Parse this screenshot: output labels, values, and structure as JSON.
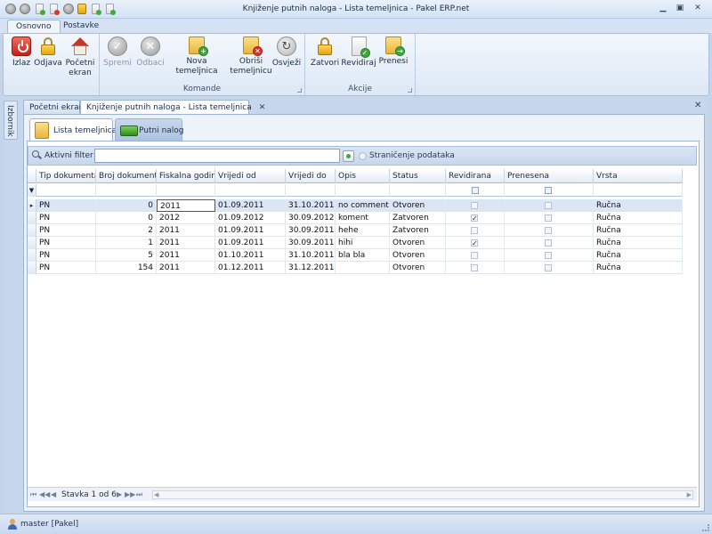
{
  "window": {
    "title": "Knjiženje putnih naloga - Lista temeljnica - Pakel ERP.net"
  },
  "ribbon_tabs": [
    {
      "label": "Osnovno",
      "active": true
    },
    {
      "label": "Postavke",
      "active": false
    }
  ],
  "ribbon": {
    "groups": [
      {
        "label": "",
        "buttons": [
          {
            "label": "Izlaz",
            "icon": "power-icon"
          },
          {
            "label": "Odjava",
            "icon": "lock-icon"
          },
          {
            "label": "Početni\nekran",
            "icon": "home-icon"
          }
        ]
      },
      {
        "label": "Komande",
        "buttons": [
          {
            "label": "Spremi",
            "icon": "check-icon",
            "disabled": true
          },
          {
            "label": "Odbaci",
            "icon": "cancel-icon",
            "disabled": true
          },
          {
            "label": "Nova temeljnica",
            "icon": "new-folder-icon"
          },
          {
            "label": "Obriši\ntemeljnicu",
            "icon": "delete-folder-icon"
          },
          {
            "label": "Osvježi",
            "icon": "refresh-icon"
          }
        ]
      },
      {
        "label": "Akcije",
        "buttons": [
          {
            "label": "Zatvori",
            "icon": "lock-icon"
          },
          {
            "label": "Revidiraj",
            "icon": "revise-icon"
          },
          {
            "label": "Prenesi",
            "icon": "transfer-icon"
          }
        ]
      }
    ]
  },
  "sidebar": {
    "label": "Izbornik"
  },
  "doc_tabs": [
    {
      "label": "Početni ekran",
      "active": false
    },
    {
      "label": "Knjiženje putnih naloga - Lista temeljnica",
      "active": true,
      "close": "✕"
    }
  ],
  "workspace_close": "✕",
  "inner_tabs": [
    {
      "label": "Lista temeljnica",
      "active": true,
      "icon": "folder-icon"
    },
    {
      "label": "Putni nalog",
      "active": false,
      "icon": "truck-icon"
    }
  ],
  "filter": {
    "label": "Aktivni filter",
    "value": "",
    "paging_label": "Straničenje podataka",
    "paging_checked": false
  },
  "grid": {
    "columns": [
      "Tip dokumenta",
      "Broj dokumenta",
      "Fiskalna godina",
      "Vrijedi od",
      "Vrijedi do",
      "Opis",
      "Status",
      "Revidirana",
      "Prenesena",
      "Vrsta"
    ],
    "rows": [
      {
        "tip": "PN",
        "broj": "0",
        "godina": "2011",
        "od": "01.09.2011",
        "do": "31.10.2011",
        "opis": "no comment",
        "status": "Otvoren",
        "revidirana": false,
        "prenesena": false,
        "vrsta": "Ručna",
        "selected": true
      },
      {
        "tip": "PN",
        "broj": "0",
        "godina": "2012",
        "od": "01.09.2012",
        "do": "30.09.2012",
        "opis": "koment",
        "status": "Zatvoren",
        "revidirana": true,
        "prenesena": false,
        "vrsta": "Ručna"
      },
      {
        "tip": "PN",
        "broj": "2",
        "godina": "2011",
        "od": "01.09.2011",
        "do": "30.09.2011",
        "opis": "hehe",
        "status": "Zatvoren",
        "revidirana": false,
        "prenesena": false,
        "vrsta": "Ručna"
      },
      {
        "tip": "PN",
        "broj": "1",
        "godina": "2011",
        "od": "01.09.2011",
        "do": "30.09.2011",
        "opis": "hihi",
        "status": "Otvoren",
        "revidirana": true,
        "prenesena": false,
        "vrsta": "Ručna"
      },
      {
        "tip": "PN",
        "broj": "5",
        "godina": "2011",
        "od": "01.10.2011",
        "do": "31.10.2011",
        "opis": "bla bla",
        "status": "Otvoren",
        "revidirana": false,
        "prenesena": false,
        "vrsta": "Ručna"
      },
      {
        "tip": "PN",
        "broj": "154",
        "godina": "2011",
        "od": "01.12.2011",
        "do": "31.12.2011",
        "opis": "",
        "status": "Otvoren",
        "revidirana": false,
        "prenesena": false,
        "vrsta": "Ručna"
      }
    ]
  },
  "navigator": {
    "text": "Stavka 1 od 6"
  },
  "status": {
    "user": "master [Pakel]"
  }
}
